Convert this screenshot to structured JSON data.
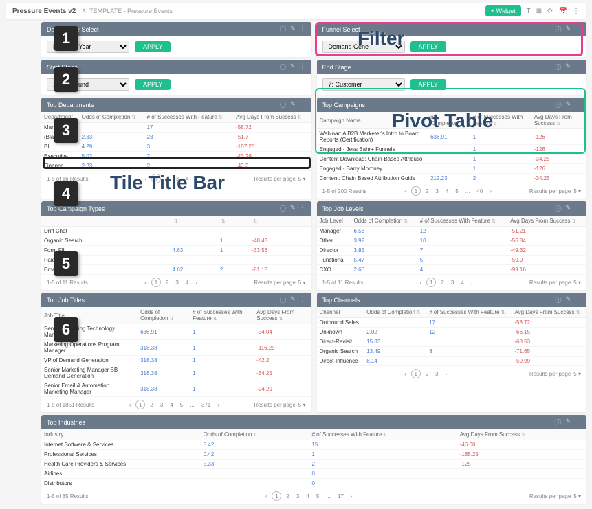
{
  "topbar": {
    "title": "Pressure Events v2",
    "template": "↻ TEMPLATE - Pressure Events",
    "widget": "+ Widget"
  },
  "tiles": {
    "dateRange": {
      "title": "Date Range Select",
      "select": "Previous Year",
      "apply": "APPLY"
    },
    "funnel": {
      "title": "Funnel Select",
      "select": "Demand Gene",
      "apply": "APPLY"
    },
    "startStage": {
      "title": "Start Stage",
      "select": "1: Is Inbound",
      "apply": "APPLY"
    },
    "endStage": {
      "title": "End Stage",
      "select": "7: Customer",
      "apply": "APPLY"
    },
    "topDepartments": {
      "title": "Top Departments",
      "cols": [
        "Department",
        "Odds of Completion",
        "# of Successes With Feature",
        "Avg Days From Success"
      ],
      "rows": [
        [
          "Marketing",
          "",
          "17",
          "-58.72"
        ],
        [
          "(Blank)",
          "2.33",
          "23",
          "-51.7"
        ],
        [
          "BI",
          "4.29",
          "3",
          "-107.25"
        ],
        [
          "Executive",
          "5.02",
          "2",
          "-43.29"
        ],
        [
          "Finance",
          "2.23",
          "2",
          "-42.2"
        ]
      ],
      "footerL": "1-5 of 16 Results",
      "pages": [
        "1",
        "2",
        "3",
        "4"
      ],
      "rpp": "Results per page",
      "rppn": "5"
    },
    "topCampaigns": {
      "title": "Top Campaigns",
      "cols": [
        "Campaign Name",
        "of Completion",
        "# of Successes With Feature",
        "Avg Days From Success"
      ],
      "rows": [
        [
          "Webinar: A B2B Marketer's Intro to Board Reports (Certification)",
          "636.91",
          "1",
          "-126"
        ],
        [
          "Engaged - Jess Bahr+ Funnels",
          "",
          "1",
          "-126"
        ],
        [
          "Content Download: Chain-Based Attributio",
          "",
          "1",
          "-34.25"
        ],
        [
          "Engaged - Barry Moroney",
          "",
          "1",
          "-126"
        ],
        [
          "Content: Chain Based Attribution Guide",
          "212.23",
          "2",
          "-34.25"
        ]
      ],
      "footerL": "1-5 of 200 Results",
      "pages": [
        "1",
        "2",
        "3",
        "4",
        "5",
        "...",
        "40"
      ],
      "rpp": "Results per page",
      "rppn": "5"
    },
    "topCampaignTypes": {
      "title": "Top Campaign Types",
      "cols": [
        "",
        "",
        "",
        ""
      ],
      "rows": [
        [
          "Drift Chat",
          "",
          "",
          ""
        ],
        [
          "Organic Search",
          "",
          "1",
          "-48.43"
        ],
        [
          "Form Fill",
          "4.63",
          "1",
          "-33.56"
        ],
        [
          "Paid Search",
          "",
          "",
          ""
        ],
        [
          "Email",
          "4.62",
          "2",
          "-81.13"
        ]
      ],
      "footerL": "1-5 of 11 Results",
      "pages": [
        "1",
        "2",
        "3",
        "4"
      ],
      "rpp": "Results per page",
      "rppn": "5"
    },
    "topJobLevels": {
      "title": "Top Job Levels",
      "cols": [
        "Job Level",
        "Odds of Completion",
        "# of Successes With Feature",
        "Avg Days From Success"
      ],
      "rows": [
        [
          "Manager",
          "6.58",
          "12",
          "-51.21"
        ],
        [
          "Other",
          "3.92",
          "10",
          "-56.84"
        ],
        [
          "Director",
          "3.85",
          "7",
          "-49.32"
        ],
        [
          "Functional",
          "5.47",
          "5",
          "-59.9"
        ],
        [
          "CXO",
          "2.60",
          "4",
          "-99.16"
        ]
      ],
      "footerL": "1-5 of 11 Results",
      "pages": [
        "1",
        "2",
        "3",
        "4"
      ],
      "rpp": "Results per page",
      "rppn": "5"
    },
    "topJobTitles": {
      "title": "Top Job Titles",
      "cols": [
        "Job Title",
        "Odds of Completion",
        "# of Successes With Feature",
        "Avg Days From Success"
      ],
      "rows": [
        [
          "Senior Marketing Technology Manager",
          "636.91",
          "1",
          "-34.04"
        ],
        [
          "Marketing Operations Program Manager",
          "318.38",
          "1",
          "-116.29"
        ],
        [
          "VP of Demand Generation",
          "318.38",
          "1",
          "-42.2"
        ],
        [
          "Senior Marketing Manager BB Demand Generation",
          "318.38",
          "1",
          "-34.25"
        ],
        [
          "Senior Email & Automation Marketing Manager",
          "318.38",
          "1",
          "-24.29"
        ]
      ],
      "footerL": "1-5 of 1851 Results",
      "pages": [
        "1",
        "2",
        "3",
        "4",
        "5",
        "...",
        "371"
      ],
      "rpp": "Results per page",
      "rppn": "5"
    },
    "topChannels": {
      "title": "Top Channels",
      "cols": [
        "Channel",
        "Odds of Completion",
        "# of Successes With Feature",
        "Avg Days From Success"
      ],
      "rows": [
        [
          "Outbound Sales",
          "",
          "17",
          "-58.72"
        ],
        [
          "Unknown",
          "2.02",
          "12",
          "-66.15"
        ],
        [
          "Direct-Revisit",
          "15.83",
          "",
          "-68.53"
        ],
        [
          "Organic Search",
          "13.49",
          "8",
          "-71.65"
        ],
        [
          "Direct-Influence",
          "8.14",
          "",
          "-50.99"
        ]
      ],
      "footerL": "",
      "pages": [
        "1",
        "2",
        "3"
      ],
      "rpp": "Results per page",
      "rppn": "5"
    },
    "topIndustries": {
      "title": "Top Industries",
      "cols": [
        "Industry",
        "Odds of Completion",
        "# of Successes With Feature",
        "Avg Days From Success"
      ],
      "rows": [
        [
          "Internet Software & Services",
          "5.42",
          "15",
          "-46.00"
        ],
        [
          "Professional Services",
          "0.42",
          "1",
          "-185.25"
        ],
        [
          "Health Care Providers & Services",
          "5.33",
          "2",
          "-125"
        ],
        [
          "Airlines",
          "",
          "0",
          ""
        ],
        [
          "Distributors",
          "",
          "0",
          ""
        ]
      ],
      "footerL": "1-5 of 85 Results",
      "pages": [
        "1",
        "2",
        "3",
        "4",
        "5",
        "...",
        "17"
      ],
      "rpp": "Results per page",
      "rppn": "5"
    }
  },
  "annotations": {
    "filter": "Filter",
    "pivot": "Pivot Table",
    "titlebar": "Tile Title Bar",
    "nums": [
      "1",
      "2",
      "3",
      "4",
      "5",
      "6"
    ]
  }
}
